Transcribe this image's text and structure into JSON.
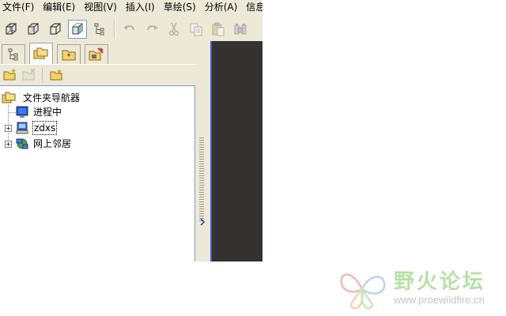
{
  "menubar": {
    "items": [
      {
        "label": "文件(F)"
      },
      {
        "label": "编辑(E)"
      },
      {
        "label": "视图(V)"
      },
      {
        "label": "插入(I)"
      },
      {
        "label": "草绘(S)"
      },
      {
        "label": "分析(A)"
      },
      {
        "label": "信息"
      }
    ]
  },
  "toolbar": {
    "icons": [
      "wireframe-cube-icon",
      "hidden-line-cube-icon",
      "no-hidden-cube-icon",
      "shaded-cube-icon",
      "model-tree-icon",
      "undo-icon",
      "redo-icon",
      "cut-icon",
      "copy-icon",
      "paste-icon",
      "paste-special-icon"
    ],
    "active": "shaded-cube-icon"
  },
  "navigator": {
    "tabs": [
      "model-tree-tab",
      "folder-browser-tab",
      "favorites-tab",
      "connections-tab"
    ],
    "selected_tab": "folder-browser-tab"
  },
  "folder_tools": [
    "new-folder-icon",
    "delete-folder-icon",
    "add-favorite-icon"
  ],
  "tree": {
    "header": "文件夹导航器",
    "nodes": [
      {
        "label": "进程中",
        "icon": "monitor-icon"
      },
      {
        "label": "zdxs",
        "icon": "computer-icon"
      },
      {
        "label": "网上邻居",
        "icon": "network-icon"
      }
    ]
  },
  "colors": {
    "chrome": "#ece9d8",
    "graphics_bg": "#333230",
    "sash_line": "#4a5ecc"
  },
  "watermark": {
    "title": "野火论坛",
    "url": "www.proewildfire.cn"
  }
}
